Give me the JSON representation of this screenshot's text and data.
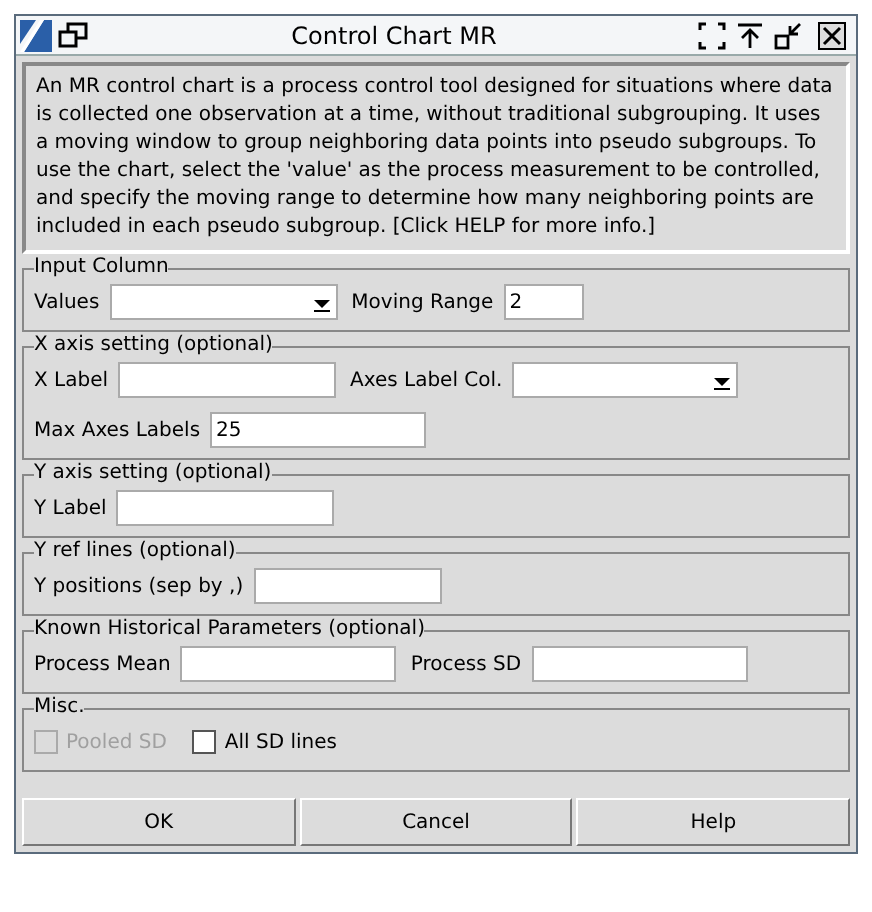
{
  "window": {
    "title": "Control Chart MR"
  },
  "description": "An MR control chart is a process control tool designed for situations where data is collected one observation at a time, without traditional subgrouping. It uses a moving window to group neighboring data points into pseudo subgroups. To use the chart, select the 'value' as the process measurement to be controlled, and specify the moving range to determine how many neighboring points are included in each pseudo subgroup. [Click HELP for more info.]",
  "groups": [
    {
      "title": "Input Column",
      "rows": [
        [
          {
            "kind": "label",
            "text": "Values"
          },
          {
            "kind": "combo"
          },
          {
            "kind": "label",
            "text": "Moving Range"
          },
          {
            "kind": "text",
            "value": "2"
          }
        ]
      ]
    },
    {
      "title": "X axis setting (optional)",
      "rows": [
        [
          {
            "kind": "label",
            "text": "X Label"
          },
          {
            "kind": "text"
          },
          {
            "kind": "label",
            "text": "Axes Label Col."
          },
          {
            "kind": "combo"
          }
        ],
        [
          {
            "kind": "label",
            "text": "Max Axes Labels"
          },
          {
            "kind": "text",
            "value": "25"
          }
        ]
      ]
    },
    {
      "title": "Y axis setting (optional)",
      "rows": [
        [
          {
            "kind": "label",
            "text": "Y Label"
          },
          {
            "kind": "text"
          }
        ]
      ]
    },
    {
      "title": "Y ref lines (optional)",
      "rows": [
        [
          {
            "kind": "label",
            "text": "Y positions (sep by ,)"
          },
          {
            "kind": "text"
          }
        ]
      ]
    },
    {
      "title": "Known Historical Parameters (optional)",
      "rows": [
        [
          {
            "kind": "label",
            "text": "Process Mean"
          },
          {
            "kind": "text"
          },
          {
            "kind": "label",
            "text": "Process SD"
          },
          {
            "kind": "text"
          }
        ]
      ]
    },
    {
      "title": "Misc.",
      "rows": [
        [
          {
            "kind": "checkbox",
            "text": "Pooled SD",
            "checked": false,
            "disabled": true
          },
          {
            "kind": "checkbox",
            "text": "All SD lines",
            "checked": false,
            "disabled": false
          }
        ]
      ]
    }
  ],
  "buttons": [
    "OK",
    "Cancel",
    "Help"
  ]
}
